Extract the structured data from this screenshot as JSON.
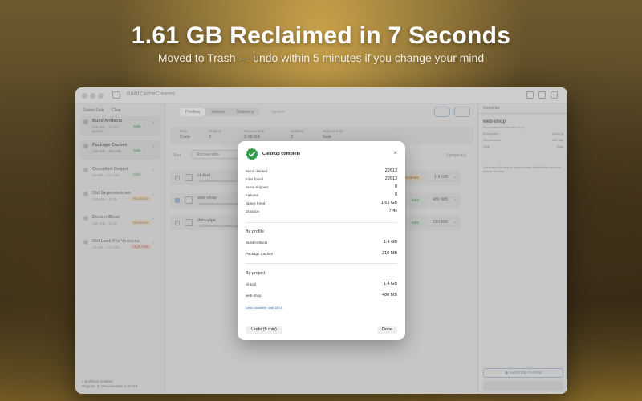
{
  "hero": {
    "title": "1.61 GB Reclaimed in 7 Seconds",
    "subtitle": "Moved to Trash — undo within 5 minutes if you change your mind"
  },
  "window": {
    "app_name": "BuildCacheCleaner"
  },
  "sidebar": {
    "select_safe": "Select Safe",
    "clear": "Clear",
    "items": [
      {
        "name": "Build Artifacts",
        "size": "558 MB – 2 GB / project",
        "badge": "Safe",
        "risk": "safe"
      },
      {
        "name": "Package Caches",
        "size": "100 MB – 500 MB",
        "badge": "Safe",
        "risk": "safe"
      },
      {
        "name": "Compiled Output",
        "size": "50 MB – 200 MB",
        "badge": "Safe",
        "risk": "safe"
      },
      {
        "name": "Old Dependencies",
        "size": "200 MB – 1 GB",
        "badge": "Moderate",
        "risk": "mod"
      },
      {
        "name": "Docker Bloat",
        "size": "100 MB – 5 GB",
        "badge": "Moderate",
        "risk": "mod"
      },
      {
        "name": "Old Lock File Versions",
        "size": "10 MB – 100 MB",
        "badge": "High Risk",
        "risk": "high"
      }
    ],
    "footer_line1": "2 profile(s) enabled",
    "footer_line2": "Projects: 3 · Recoverable: 2.09 GB"
  },
  "main": {
    "tabs": [
      "Profiles",
      "History",
      "Statistics"
    ],
    "active_tab": "Profiles",
    "search_placeholder": "Search",
    "stats": [
      {
        "label": "Root",
        "value": "Code"
      },
      {
        "label": "Projects",
        "value": "3"
      },
      {
        "label": "Recoverable",
        "value": "2.09 GB"
      },
      {
        "label": "Enabled",
        "value": "2"
      },
      {
        "label": "Highest Risk",
        "value": "Safe"
      }
    ],
    "sort_label": "Sort",
    "filter_label": "Recoverable",
    "project_count": "3 project(s)",
    "rows": [
      {
        "name": "cli-tool",
        "path": "~/Users/demo/Code/cli-tool",
        "badge": "Moderate",
        "risk": "mod",
        "size": "1.4 GB",
        "checked": false
      },
      {
        "name": "web-shop",
        "path": "~/Users/demo/Code/web-shop",
        "badge": "Safe",
        "risk": "safe",
        "size": "480 MB",
        "checked": true
      },
      {
        "name": "data-pipe",
        "path": "~/Users/demo/Code/data-pipe",
        "badge": "Safe",
        "risk": "safe",
        "size": "210 MB",
        "checked": false
      }
    ]
  },
  "inspector": {
    "title": "Inspector",
    "name": "web-shop",
    "path": "/Users/demo/Code/web-shop",
    "kv": [
      {
        "k": "Ecosystem",
        "v": "Node.js"
      },
      {
        "k": "Recoverable",
        "v": "480 MB"
      },
      {
        "k": "Risk",
        "v": "Safe"
      }
    ],
    "description": "Generate Preview to inspect exact folders/files and risk before cleanup.",
    "generate_btn": "Generate Preview"
  },
  "modal": {
    "title": "Cleanup complete",
    "close": "×",
    "summary": [
      {
        "k": "Items deleted",
        "v": "22613"
      },
      {
        "k": "Files found",
        "v": "22613"
      },
      {
        "k": "Items skipped",
        "v": "0"
      },
      {
        "k": "Failures",
        "v": "0"
      },
      {
        "k": "Space freed",
        "v": "1.61 GB"
      },
      {
        "k": "Duration",
        "v": "7.4s"
      }
    ],
    "by_profile_title": "By profile",
    "by_profile": [
      {
        "k": "Build Artifacts",
        "v": "1.4 GB"
      },
      {
        "k": "Package Caches",
        "v": "210 MB"
      }
    ],
    "by_project_title": "By project",
    "by_project": [
      {
        "k": "cli-tool",
        "v": "1.4 GB"
      },
      {
        "k": "web-shop",
        "v": "480 MB"
      }
    ],
    "undo_note": "Undo available until 18:16.",
    "undo_btn": "Undo (5 min)",
    "done_btn": "Done"
  },
  "colors": {
    "accent": "#3b6fb6",
    "success": "#2e9b48"
  }
}
